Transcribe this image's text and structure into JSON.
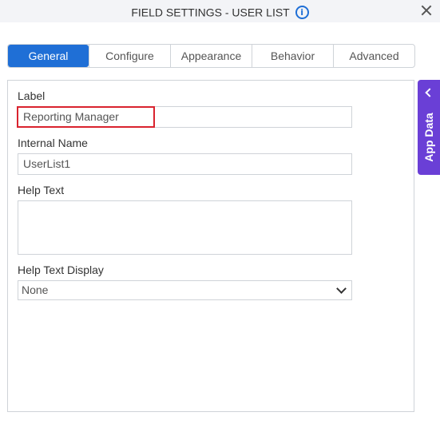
{
  "header": {
    "title": "FIELD SETTINGS - USER LIST",
    "info_icon": "i",
    "close_icon": "close-icon"
  },
  "tabs": [
    {
      "label": "General",
      "active": true
    },
    {
      "label": "Configure",
      "active": false
    },
    {
      "label": "Appearance",
      "active": false
    },
    {
      "label": "Behavior",
      "active": false
    },
    {
      "label": "Advanced",
      "active": false
    }
  ],
  "form": {
    "label": {
      "title": "Label",
      "value": "Reporting Manager"
    },
    "internal_name": {
      "title": "Internal Name",
      "value": "UserList1"
    },
    "help_text": {
      "title": "Help Text",
      "value": ""
    },
    "help_text_display": {
      "title": "Help Text Display",
      "value": "None"
    }
  },
  "side_panel": {
    "label": "App Data"
  },
  "colors": {
    "accent": "#1f6fd6",
    "highlight": "#d9232e",
    "app_data": "#6a3fd6"
  }
}
